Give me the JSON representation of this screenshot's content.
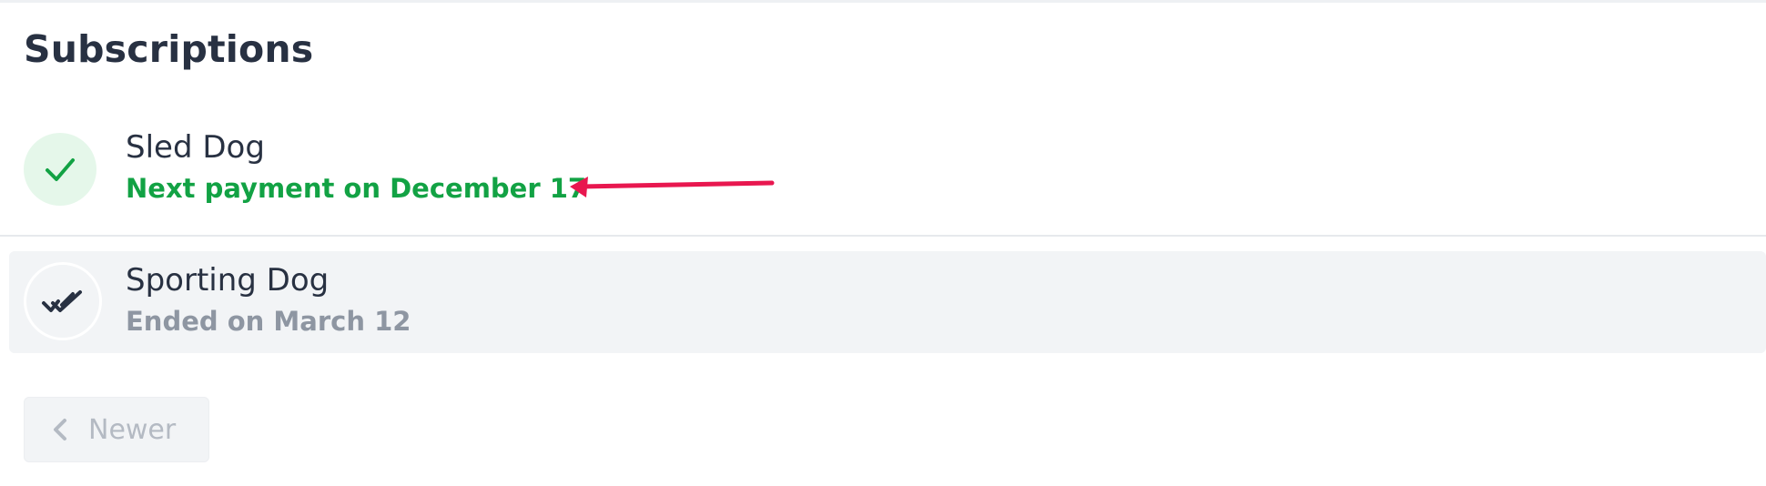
{
  "page": {
    "title": "Subscriptions"
  },
  "subscriptions": [
    {
      "name": "Sled Dog",
      "status_text": "Next payment on December 17",
      "state": "active",
      "icon": "check-icon",
      "status_color": "#12a244"
    },
    {
      "name": "Sporting Dog",
      "status_text": "Ended on March 12",
      "state": "ended",
      "icon": "double-check-icon",
      "status_color": "#8e96a2"
    }
  ],
  "pagination": {
    "newer_label": "Newer",
    "newer_icon": "chevron-left-icon",
    "newer_enabled": false
  },
  "annotation": {
    "icon": "arrow-left-icon",
    "color": "#e8174f"
  },
  "colors": {
    "title": "#283142",
    "active_green": "#12a244",
    "active_bg": "#e5f7ea",
    "ended_row_bg": "#f2f4f6",
    "muted_text": "#8e96a2"
  }
}
